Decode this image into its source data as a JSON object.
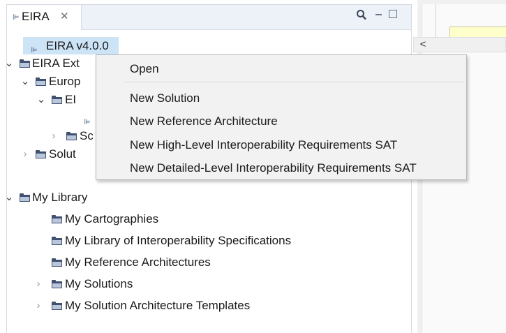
{
  "view": {
    "tab_title": "EIRA",
    "tab_close_glyph": "✕",
    "toolbar_icons": [
      "search-icon",
      "minimize-icon",
      "maximize-icon"
    ]
  },
  "tree": {
    "selected_label": "EIRA v4.0.0",
    "items": [
      {
        "label": "EIRA v4.0.0"
      },
      {
        "label": "EIRA Ext"
      },
      {
        "label": "Europ"
      },
      {
        "label": "EI"
      },
      {
        "label": ""
      },
      {
        "label": "Sc"
      },
      {
        "label": "Solut"
      },
      {
        "label": "My Library"
      },
      {
        "label": "My Cartographies"
      },
      {
        "label": "My Library of Interoperability Specifications"
      },
      {
        "label": "My Reference Architectures"
      },
      {
        "label": "My Solutions"
      },
      {
        "label": "My Solution Architecture Templates"
      }
    ]
  },
  "context_menu": {
    "items": [
      {
        "label": "Open"
      },
      {
        "label": "New Solution"
      },
      {
        "label": "New Reference Architecture"
      },
      {
        "label": "New High-Level Interoperability Requirements SAT"
      },
      {
        "label": "New Detailed-Level Interoperability Requirements SAT"
      }
    ]
  },
  "editor": {
    "scroll_left_glyph": "<",
    "sticky_note_color": "#ffffcc"
  },
  "colors": {
    "selection": "#cde4f7",
    "folder": "#3f5070",
    "menu_bg": "#f2f2f2"
  }
}
